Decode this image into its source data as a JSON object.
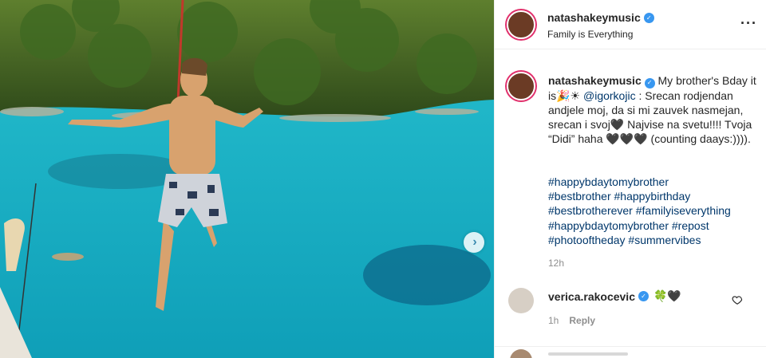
{
  "post": {
    "username": "natashakeymusic",
    "location": "Family is Everything",
    "more_icon": "more-options-icon",
    "caption": {
      "text_1": " My brother's Bday it is",
      "emoji_1": "🎉☀",
      "mention": "@igorkojic",
      "text_2": " : Srecan rodjendan andjele moj, da si mi zauvek nasmejan, srecan i svoj",
      "heart_1": "🖤",
      "text_3": " Najvise na svetu!!!! Tvoja “Didi” haha ",
      "hearts_2": "🖤🖤🖤",
      "text_4": " (counting daays:)))).",
      "hashtags": [
        "#happybdaytomybrother",
        "#bestbrother",
        "#happybirthday",
        "#bestbrotherever",
        "#familyiseverything",
        "#happybdaytomybrother",
        "#repost",
        "#photooftheday",
        "#summervibes"
      ],
      "time": "12h"
    },
    "comment": {
      "username": "verica.rakocevic",
      "text": "🍀🖤",
      "time": "1h",
      "reply_label": "Reply"
    },
    "colors": {
      "accent_link": "#00376b",
      "verified": "#3897f0",
      "story_ring": "#e1306c",
      "sea": "#1fb0c4"
    }
  }
}
